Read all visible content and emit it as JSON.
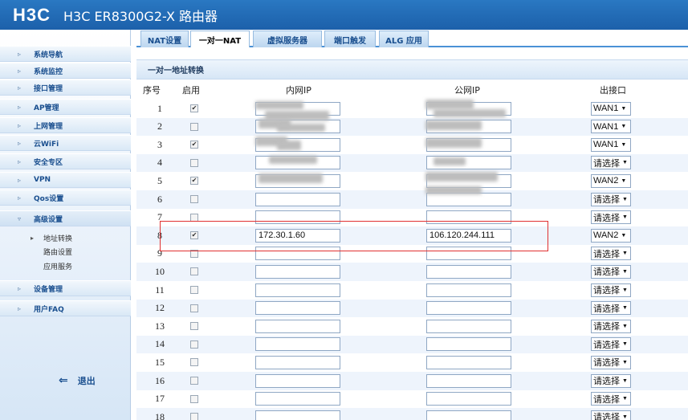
{
  "header": {
    "logo": "H3C",
    "title": "H3C ER8300G2-X 路由器"
  },
  "sidebar": {
    "items": [
      {
        "label": "系统导航",
        "arrow": "▹"
      },
      {
        "label": "系统监控",
        "arrow": "▹"
      },
      {
        "label": "接口管理",
        "arrow": "▹"
      },
      {
        "label": "AP管理",
        "arrow": "▹"
      },
      {
        "label": "上网管理",
        "arrow": "▹"
      },
      {
        "label": "云WiFi",
        "arrow": "▹"
      },
      {
        "label": "安全专区",
        "arrow": "▹"
      },
      {
        "label": "VPN",
        "arrow": "▹"
      },
      {
        "label": "Qos设置",
        "arrow": "▹"
      },
      {
        "label": "高级设置",
        "arrow": "▿"
      },
      {
        "label": "设备管理",
        "arrow": "▹"
      },
      {
        "label": "用户FAQ",
        "arrow": "▹"
      }
    ],
    "subitems": [
      "地址转换",
      "路由设置",
      "应用服务"
    ],
    "subitem_marker": "▸",
    "logout": "退出",
    "logout_icon": "⇐"
  },
  "tabs": [
    {
      "label": "NAT设置"
    },
    {
      "label": "一对一NAT"
    },
    {
      "label": "虚拟服务器"
    },
    {
      "label": "端口触发"
    },
    {
      "label": "ALG 应用"
    }
  ],
  "section_title": "一对一地址转换",
  "table": {
    "headers": {
      "idx": "序号",
      "enabled": "启用",
      "inner": "内网IP",
      "public": "公网IP",
      "iface": "出接口"
    },
    "check_mark": "✔",
    "caret": "▼",
    "rows": [
      {
        "idx": "1",
        "enabled": true,
        "inner": "",
        "public": "",
        "iface": "WAN1"
      },
      {
        "idx": "2",
        "enabled": false,
        "inner": "",
        "public": "",
        "iface": "WAN1"
      },
      {
        "idx": "3",
        "enabled": true,
        "inner": "",
        "public": "",
        "iface": "WAN1"
      },
      {
        "idx": "4",
        "enabled": false,
        "inner": "",
        "public": "",
        "iface": "请选择"
      },
      {
        "idx": "5",
        "enabled": true,
        "inner": "",
        "public": "",
        "iface": "WAN2"
      },
      {
        "idx": "6",
        "enabled": false,
        "inner": "",
        "public": "",
        "iface": "请选择"
      },
      {
        "idx": "7",
        "enabled": false,
        "inner": "",
        "public": "",
        "iface": "请选择"
      },
      {
        "idx": "8",
        "enabled": true,
        "inner": "172.30.1.60",
        "public": "106.120.244.111",
        "iface": "WAN2"
      },
      {
        "idx": "9",
        "enabled": false,
        "inner": "",
        "public": "",
        "iface": "请选择"
      },
      {
        "idx": "10",
        "enabled": false,
        "inner": "",
        "public": "",
        "iface": "请选择"
      },
      {
        "idx": "11",
        "enabled": false,
        "inner": "",
        "public": "",
        "iface": "请选择"
      },
      {
        "idx": "12",
        "enabled": false,
        "inner": "",
        "public": "",
        "iface": "请选择"
      },
      {
        "idx": "13",
        "enabled": false,
        "inner": "",
        "public": "",
        "iface": "请选择"
      },
      {
        "idx": "14",
        "enabled": false,
        "inner": "",
        "public": "",
        "iface": "请选择"
      },
      {
        "idx": "15",
        "enabled": false,
        "inner": "",
        "public": "",
        "iface": "请选择"
      },
      {
        "idx": "16",
        "enabled": false,
        "inner": "",
        "public": "",
        "iface": "请选择"
      },
      {
        "idx": "17",
        "enabled": false,
        "inner": "",
        "public": "",
        "iface": "请选择"
      },
      {
        "idx": "18",
        "enabled": false,
        "inner": "",
        "public": "",
        "iface": "请选择"
      }
    ]
  }
}
